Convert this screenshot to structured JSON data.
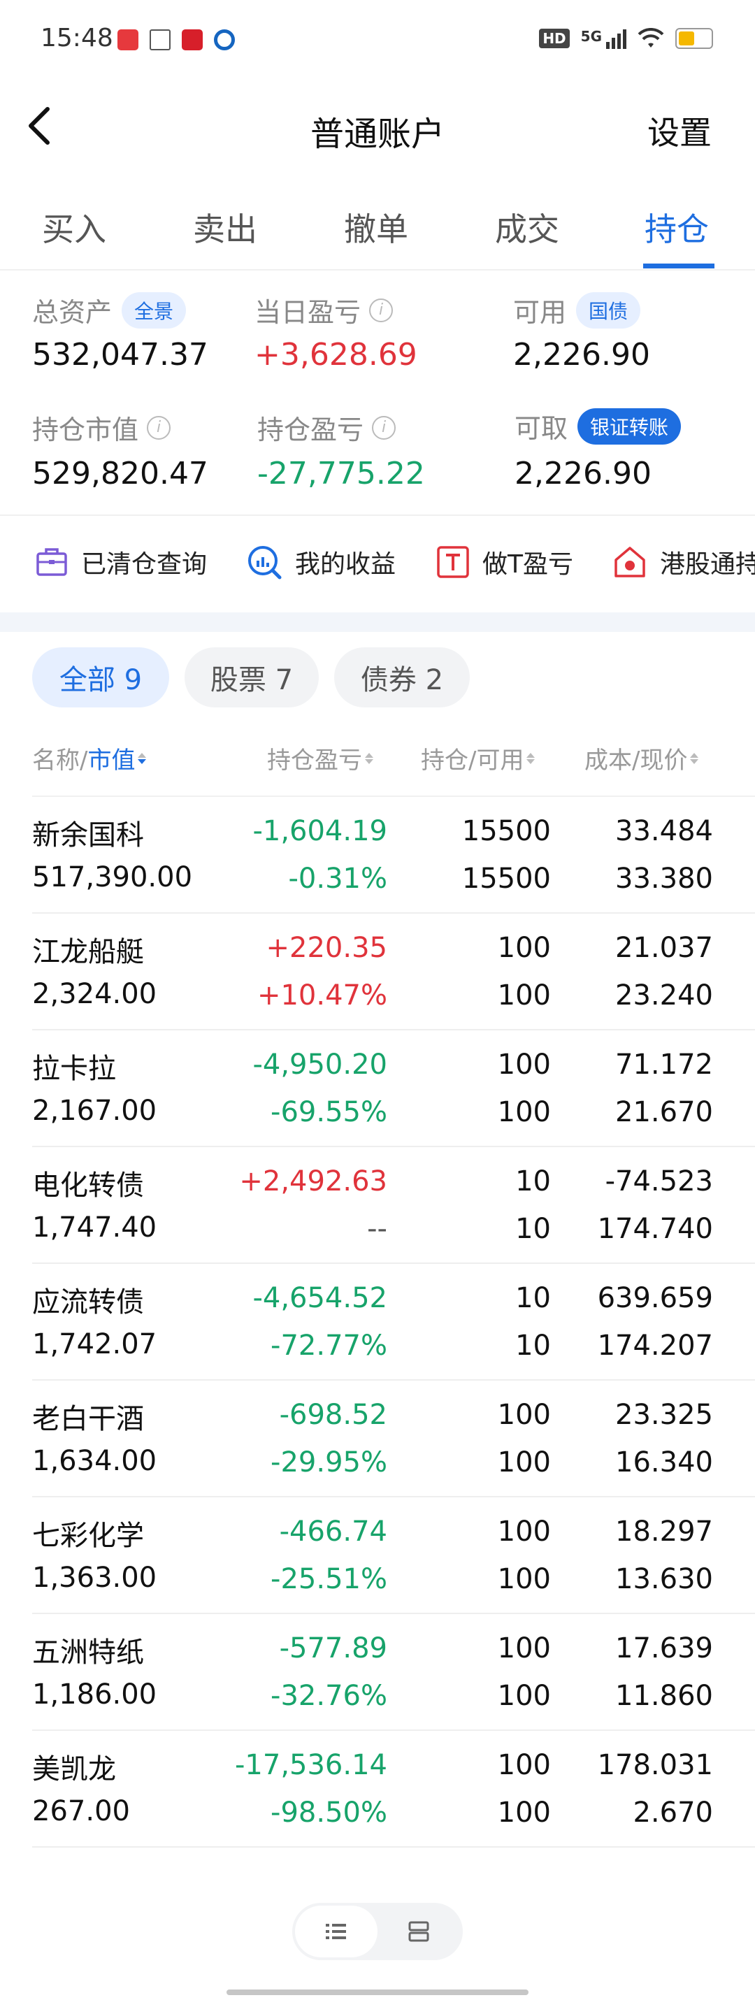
{
  "status_bar": {
    "time": "15:48",
    "network": "5G",
    "hd": "HD"
  },
  "header": {
    "title": "普通账户",
    "settings_label": "设置"
  },
  "tabs": [
    {
      "label": "买入"
    },
    {
      "label": "卖出"
    },
    {
      "label": "撤单"
    },
    {
      "label": "成交"
    },
    {
      "label": "持仓",
      "active": true
    }
  ],
  "summary": {
    "total_assets": {
      "label": "总资产",
      "badge": "全景",
      "value": "532,047.37"
    },
    "daily_pl": {
      "label": "当日盈亏",
      "value": "+3,628.69"
    },
    "available": {
      "label": "可用",
      "badge": "国债",
      "value": "2,226.90"
    },
    "position_value": {
      "label": "持仓市值",
      "value": "529,820.47"
    },
    "position_pl": {
      "label": "持仓盈亏",
      "value": "-27,775.22"
    },
    "withdrawable": {
      "label": "可取",
      "badge": "银证转账",
      "value": "2,226.90"
    }
  },
  "quick_links": [
    {
      "label": "已清仓查询",
      "icon": "briefcase-icon"
    },
    {
      "label": "我的收益",
      "icon": "chart-search-icon"
    },
    {
      "label": "做T盈亏",
      "icon": "t-box-icon"
    },
    {
      "label": "港股通持",
      "icon": "hk-house-icon"
    }
  ],
  "filters": [
    {
      "label": "全部 9",
      "active": true
    },
    {
      "label": "股票 7"
    },
    {
      "label": "债券 2"
    }
  ],
  "table_header": {
    "name": "名称/",
    "mv": "市值",
    "pl": "持仓盈亏",
    "pos": "持仓/可用",
    "cost": "成本/现价"
  },
  "holdings": [
    {
      "name": "新余国科",
      "mv": "517,390.00",
      "pl": "-1,604.19",
      "plp": "-0.31%",
      "pos": "15500",
      "avail": "15500",
      "cost": "33.484",
      "price": "33.380",
      "dir": "green"
    },
    {
      "name": "江龙船艇",
      "mv": "2,324.00",
      "pl": "+220.35",
      "plp": "+10.47%",
      "pos": "100",
      "avail": "100",
      "cost": "21.037",
      "price": "23.240",
      "dir": "red"
    },
    {
      "name": "拉卡拉",
      "mv": "2,167.00",
      "pl": "-4,950.20",
      "plp": "-69.55%",
      "pos": "100",
      "avail": "100",
      "cost": "71.172",
      "price": "21.670",
      "dir": "green"
    },
    {
      "name": "电化转债",
      "mv": "1,747.40",
      "pl": "+2,492.63",
      "plp": "--",
      "pos": "10",
      "avail": "10",
      "cost": "-74.523",
      "price": "174.740",
      "dir": "red",
      "plp_dir": "neutral"
    },
    {
      "name": "应流转债",
      "mv": "1,742.07",
      "pl": "-4,654.52",
      "plp": "-72.77%",
      "pos": "10",
      "avail": "10",
      "cost": "639.659",
      "price": "174.207",
      "dir": "green"
    },
    {
      "name": "老白干酒",
      "mv": "1,634.00",
      "pl": "-698.52",
      "plp": "-29.95%",
      "pos": "100",
      "avail": "100",
      "cost": "23.325",
      "price": "16.340",
      "dir": "green"
    },
    {
      "name": "七彩化学",
      "mv": "1,363.00",
      "pl": "-466.74",
      "plp": "-25.51%",
      "pos": "100",
      "avail": "100",
      "cost": "18.297",
      "price": "13.630",
      "dir": "green"
    },
    {
      "name": "五洲特纸",
      "mv": "1,186.00",
      "pl": "-577.89",
      "plp": "-32.76%",
      "pos": "100",
      "avail": "100",
      "cost": "17.639",
      "price": "11.860",
      "dir": "green"
    },
    {
      "name": "美凯龙",
      "mv": "267.00",
      "pl": "-17,536.14",
      "plp": "-98.50%",
      "pos": "100",
      "avail": "100",
      "cost": "178.031",
      "price": "2.670",
      "dir": "green"
    }
  ],
  "colors": {
    "accent": "#1e6ee0",
    "up": "#e0333b",
    "down": "#17a36a"
  }
}
